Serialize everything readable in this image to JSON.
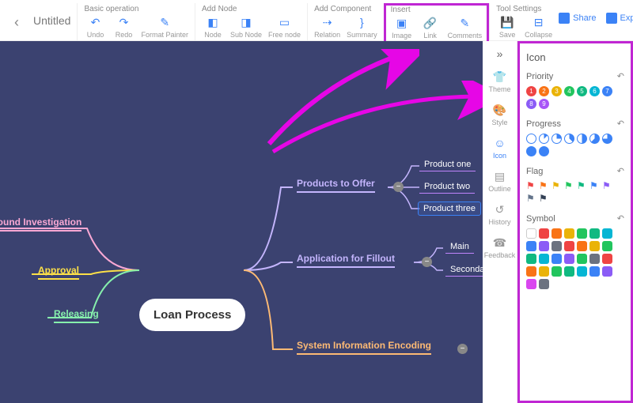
{
  "header": {
    "title": "Untitled"
  },
  "toolbar": {
    "groups": {
      "basic": {
        "label": "Basic operation",
        "undo": "Undo",
        "redo": "Redo",
        "format": "Format Painter"
      },
      "addnode": {
        "label": "Add Node",
        "node": "Node",
        "subnode": "Sub Node",
        "freenode": "Free node"
      },
      "addcomp": {
        "label": "Add Component",
        "relation": "Relation",
        "summary": "Summary"
      },
      "insert": {
        "label": "Insert",
        "image": "Image",
        "link": "Link",
        "comments": "Comments"
      },
      "settings": {
        "label": "Tool Settings",
        "save": "Save",
        "collapse": "Collapse"
      }
    },
    "share": "Share",
    "export": "Export"
  },
  "mindmap": {
    "center": "Loan Process",
    "left": {
      "b1": "round Investigation",
      "b2": "Approval",
      "b3": "Releasing"
    },
    "right": {
      "b1": "Products to Offer",
      "b1_c": {
        "c1": "Product one",
        "c2": "Product two",
        "c3": "Product three"
      },
      "b2": "Application for Fillout",
      "b2_c": {
        "c1": "Main",
        "c2": "Seconda"
      },
      "b3": "System Information Encoding"
    }
  },
  "sidebar": {
    "nav": {
      "theme": "Theme",
      "style": "Style",
      "icon": "Icon",
      "outline": "Outline",
      "history": "History",
      "feedback": "Feedback"
    },
    "panel": {
      "title": "Icon",
      "priority": {
        "label": "Priority",
        "items": [
          "1",
          "2",
          "3",
          "4",
          "5",
          "6",
          "7",
          "8",
          "9"
        ],
        "colors": [
          "#ef4444",
          "#f97316",
          "#eab308",
          "#22c55e",
          "#10b981",
          "#06b6d4",
          "#3b82f6",
          "#8b5cf6",
          "#a855f7"
        ]
      },
      "progress": {
        "label": "Progress"
      },
      "flag": {
        "label": "Flag",
        "colors": [
          "#ef4444",
          "#f97316",
          "#eab308",
          "#22c55e",
          "#10b981",
          "#3b82f6",
          "#8b5cf6",
          "#64748b",
          "#334155"
        ]
      },
      "symbol": {
        "label": "Symbol",
        "colors": [
          "#fff",
          "#ef4444",
          "#f97316",
          "#eab308",
          "#22c55e",
          "#10b981",
          "#06b6d4",
          "#3b82f6",
          "#8b5cf6",
          "#6b7280",
          "#ef4444",
          "#f97316",
          "#eab308",
          "#22c55e",
          "#10b981",
          "#06b6d4",
          "#3b82f6",
          "#8b5cf6",
          "#22c55e",
          "#6b7280",
          "#ef4444",
          "#f97316",
          "#eab308",
          "#22c55e",
          "#10b981",
          "#06b6d4",
          "#3b82f6",
          "#8b5cf6",
          "#d946ef",
          "#6b7280"
        ]
      }
    }
  }
}
